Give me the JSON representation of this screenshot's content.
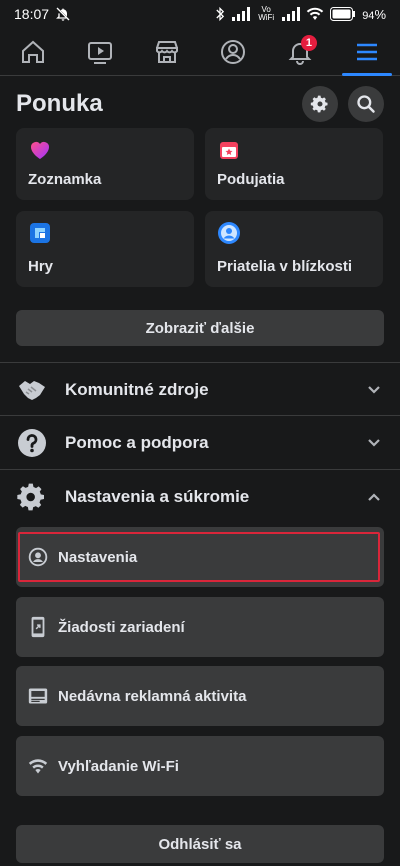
{
  "status_bar": {
    "time": "18:07",
    "carrier1": "Vo WiFi",
    "battery": "94"
  },
  "nav": {
    "items": [
      {
        "icon": "home-icon"
      },
      {
        "icon": "video-icon"
      },
      {
        "icon": "marketplace-icon"
      },
      {
        "icon": "profile-icon"
      },
      {
        "icon": "bell-icon",
        "badge": "1"
      },
      {
        "icon": "menu-icon",
        "active": true
      }
    ]
  },
  "header": {
    "title": "Ponuka"
  },
  "tiles": [
    {
      "label": "Zoznamka",
      "icon": "heart-icon"
    },
    {
      "label": "Podujatia",
      "icon": "calendar-star-icon"
    },
    {
      "label": "Hry",
      "icon": "games-icon"
    },
    {
      "label": "Priatelia v blízkosti",
      "icon": "nearby-friends-icon"
    }
  ],
  "see_more": "Zobraziť ďalšie",
  "sections": [
    {
      "label": "Komunitné zdroje",
      "icon": "handshake-icon",
      "expanded": false
    },
    {
      "label": "Pomoc a podpora",
      "icon": "help-icon",
      "expanded": false
    },
    {
      "label": "Nastavenia a súkromie",
      "icon": "gear-icon",
      "expanded": true
    }
  ],
  "settings_items": [
    {
      "label": "Nastavenia",
      "icon": "account-circle-icon",
      "highlighted": true
    },
    {
      "label": "Žiadosti zariadení",
      "icon": "device-requests-icon"
    },
    {
      "label": "Nedávna reklamná aktivita",
      "icon": "ad-activity-icon"
    },
    {
      "label": "Vyhľadanie Wi-Fi",
      "icon": "wifi-icon"
    }
  ],
  "logout": "Odhlásiť sa",
  "colors": {
    "background": "#18191a",
    "card": "#242526",
    "button": "#3a3b3c",
    "accent": "#2d88ff",
    "highlight": "#d9263a",
    "badge": "#e41e3f"
  }
}
